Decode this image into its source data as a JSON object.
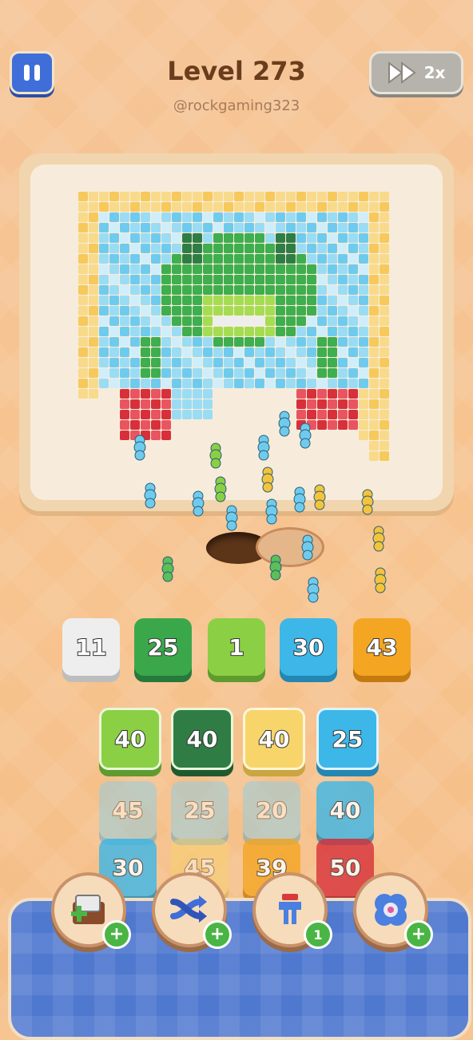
{
  "header": {
    "title": "Level 273",
    "handle": "@rockgaming323",
    "speed_label": "2x"
  },
  "colors": {
    "white": "#eeeeee",
    "green": "#3aa84a",
    "lime": "#8bcf45",
    "blue": "#3cb7e8",
    "orange": "#f4a623",
    "yellow": "#f7d56a",
    "red": "#d8303a",
    "darkgreen": "#2f7d45"
  },
  "queue": [
    {
      "value": "11",
      "color": "white"
    },
    {
      "value": "25",
      "color": "green"
    },
    {
      "value": "1",
      "color": "lime"
    },
    {
      "value": "30",
      "color": "blue"
    },
    {
      "value": "43",
      "color": "orange"
    }
  ],
  "grid": {
    "row1": [
      {
        "value": "40",
        "color": "lime"
      },
      {
        "value": "40",
        "color": "darkgreen"
      },
      {
        "value": "40",
        "color": "yellow"
      },
      {
        "value": "25",
        "color": "blue"
      }
    ],
    "row2": [
      {
        "value": "45",
        "color": "blue"
      },
      {
        "value": "25",
        "color": "blue"
      },
      {
        "value": "20",
        "color": "blue"
      },
      {
        "value": "40",
        "color": "blue"
      }
    ],
    "row3": [
      {
        "value": "30",
        "color": "blue"
      },
      {
        "value": "45",
        "color": "yellow"
      },
      {
        "value": "39",
        "color": "orange"
      },
      {
        "value": "50",
        "color": "red"
      }
    ]
  },
  "boosters": [
    {
      "name": "add-slot",
      "badge": "+"
    },
    {
      "name": "shuffle",
      "badge": "+"
    },
    {
      "name": "magnet",
      "badge": "1"
    },
    {
      "name": "fan",
      "badge": "+"
    }
  ]
}
